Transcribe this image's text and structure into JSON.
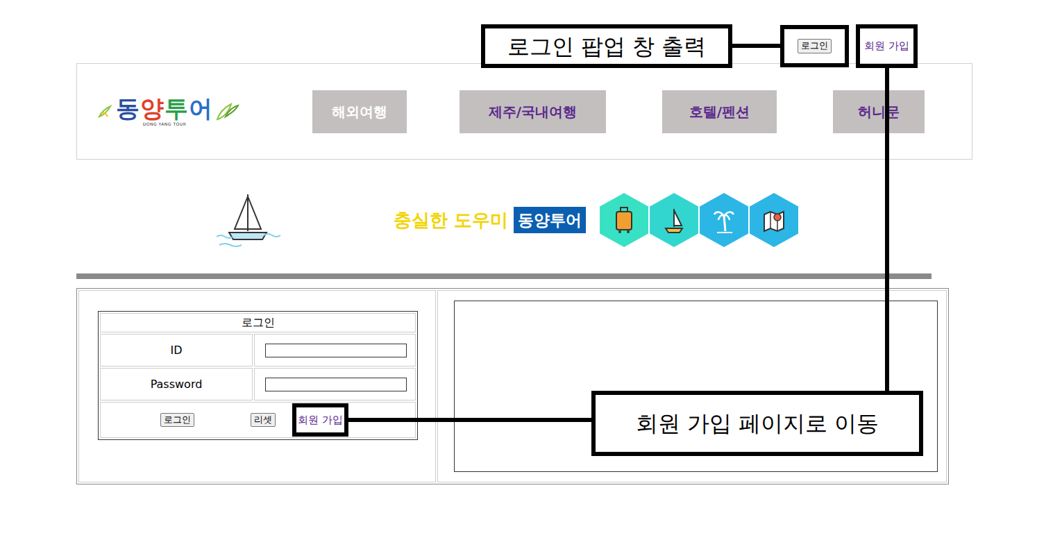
{
  "top_links": {
    "login_button": "로그인",
    "signup_link": "회원 가입"
  },
  "logo": {
    "letters": [
      {
        "text": "동",
        "color": "#2a4fa3"
      },
      {
        "text": "양",
        "color": "#e0402a"
      },
      {
        "text": "투",
        "color": "#27a046"
      },
      {
        "text": "어",
        "color": "#2a6fc9"
      }
    ],
    "subtitle": "DONG YANG TOUR"
  },
  "nav": [
    {
      "label": "해외여행",
      "selected": true
    },
    {
      "label": "제주/국내여행",
      "selected": false
    },
    {
      "label": "호텔/펜션",
      "selected": false
    },
    {
      "label": "허니문",
      "selected": false
    }
  ],
  "banner": {
    "slogan": "충실한 도우미",
    "brand": "동양투어"
  },
  "login_form": {
    "title": "로그인",
    "fields": [
      {
        "label": "ID"
      },
      {
        "label": "Password"
      }
    ],
    "buttons": [
      "로그인",
      "리셋"
    ],
    "signup_link": "회원 가입"
  },
  "annotations": [
    {
      "text": "로그인 팝업 창 출력"
    },
    {
      "text": "회원 가입 페이지로 이동"
    }
  ]
}
